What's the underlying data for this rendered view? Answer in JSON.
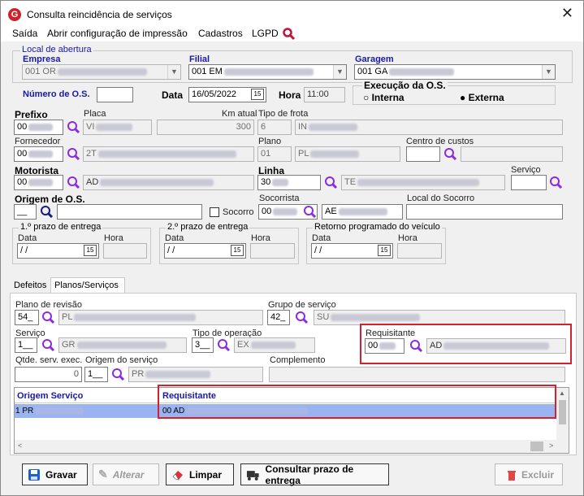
{
  "window": {
    "title": "Consulta reincidência de serviços",
    "logo_letter": "G"
  },
  "menu": {
    "items": [
      "Saída",
      "Abrir configuração de impressão",
      "Cadastros",
      "LGPD"
    ]
  },
  "local_abertura": {
    "legend": "Local de abertura",
    "empresa_label": "Empresa",
    "empresa_value": "001 OR",
    "filial_label": "Filial",
    "filial_value": "001 EM",
    "garagem_label": "Garagem",
    "garagem_value": "001 GA"
  },
  "os": {
    "numero_label": "Número de O.S.",
    "numero_value": "",
    "data_label": "Data",
    "data_value": "16/05/2022",
    "hora_label": "Hora",
    "hora_value": "11:00",
    "execucao_legend": "Execução da O.S.",
    "interna_label": "Interna",
    "externa_label": "Externa"
  },
  "fields": {
    "prefixo_label": "Prefixo",
    "prefixo_value": "00",
    "placa_label": "Placa",
    "placa_value": "VI",
    "km_label": "Km atual",
    "km_value": "300",
    "tipo_frota_label": "Tipo de frota",
    "tipo_frota_code": "6",
    "tipo_frota_value": "IN",
    "fornecedor_label": "Fornecedor",
    "fornecedor_value": "00",
    "fornecedor_name": "2T",
    "plano_label": "Plano",
    "plano_code": "01",
    "plano_value": "PL",
    "centro_label": "Centro de custos",
    "motorista_label": "Motorista",
    "motorista_value": "00",
    "motorista_name": "AD",
    "linha_label": "Linha",
    "linha_value": "30",
    "linha_name": "TE",
    "servico_label": "Serviço",
    "origem_label": "Origem de O.S.",
    "origem_value": "__",
    "socorro_label": "Socorro",
    "socorrista_label": "Socorrista",
    "socorrista_value": "00",
    "socorrista_name": "AE",
    "local_socorro_label": "Local do Socorro"
  },
  "prazos": {
    "p1_title": "1.º prazo de entrega",
    "p2_title": "2.º prazo de entrega",
    "p3_title": "Retorno programado do veículo",
    "data_label": "Data",
    "hora_label": "Hora",
    "date_value": " / /",
    "cal_icon": "15"
  },
  "tabs": {
    "defeitos": "Defeitos",
    "planos": "Planos/Serviços"
  },
  "planos": {
    "plano_revisao_label": "Plano de revisão",
    "plano_revisao_value": "54_",
    "plano_revisao_name": "PL",
    "grupo_label": "Grupo de serviço",
    "grupo_value": "42_",
    "grupo_name": "SU",
    "servico_label": "Serviço",
    "servico_value": "1__",
    "servico_name": "GR",
    "tipo_op_label": "Tipo de operação",
    "tipo_op_value": "3__",
    "tipo_op_name": "EX",
    "requisitante_label": "Requisitante",
    "requisitante_value": "00",
    "requisitante_name": "AD",
    "qtde_label": "Qtde. serv. exec.",
    "qtde_value": "0",
    "origem_servico_label": "Origem do serviço",
    "origem_servico_value": "1__",
    "origem_servico_name": "PR",
    "complemento_label": "Complemento"
  },
  "grid": {
    "columns": [
      "Origem Serviço",
      "Requisitante"
    ],
    "rows": [
      {
        "origem": "1 PR",
        "requisitante": "00      AD"
      }
    ]
  },
  "buttons": {
    "gravar": "Gravar",
    "alterar": "Alterar",
    "limpar": "Limpar",
    "consultar": "Consultar prazo de entrega",
    "excluir": "Excluir"
  },
  "colors": {
    "highlight": "#d3232a",
    "selected_row": "#99b4f0",
    "label_blue": "#1a1aa0",
    "search_icon": "#8a2be2"
  }
}
